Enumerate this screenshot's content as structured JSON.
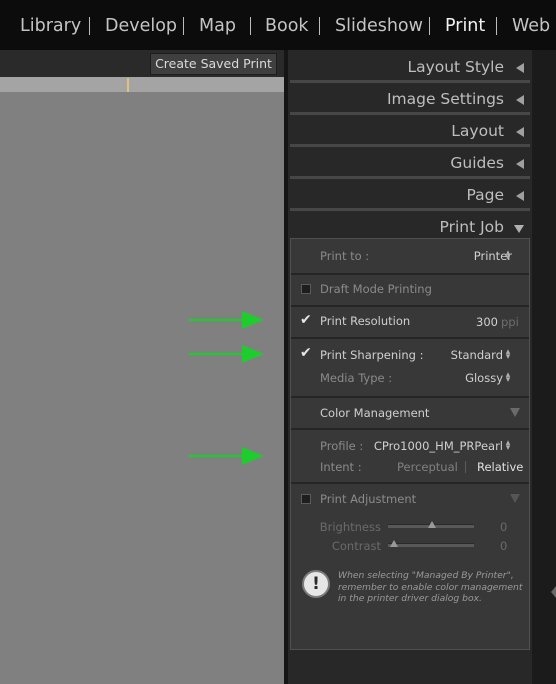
{
  "modules": [
    {
      "label": "Library",
      "active": false
    },
    {
      "label": "Develop",
      "active": false
    },
    {
      "label": "Map",
      "active": false
    },
    {
      "label": "Book",
      "active": false
    },
    {
      "label": "Slideshow",
      "active": false
    },
    {
      "label": "Print",
      "active": true
    },
    {
      "label": "Web",
      "active": false
    }
  ],
  "toolbar": {
    "create_saved_print": "Create Saved Print"
  },
  "panels": {
    "layout_style": "Layout Style",
    "image_settings": "Image Settings",
    "layout": "Layout",
    "guides": "Guides",
    "page": "Page",
    "print_job": "Print Job"
  },
  "print_job": {
    "print_to_label": "Print to :",
    "print_to_value": "Printer",
    "draft_mode": {
      "label": "Draft Mode Printing",
      "checked": false
    },
    "print_resolution": {
      "label": "Print Resolution",
      "checked": true,
      "value": "300",
      "unit": "ppi"
    },
    "print_sharpening": {
      "label": "Print Sharpening :",
      "checked": true,
      "value": "Standard"
    },
    "media_type": {
      "label": "Media Type :",
      "value": "Glossy"
    },
    "color_management": {
      "title": "Color Management",
      "profile_label": "Profile :",
      "profile_value": "CPro1000_HM_PRPearl",
      "intent_label": "Intent :",
      "intent_options": [
        "Perceptual",
        "Relative"
      ],
      "intent_selected": "Relative"
    },
    "print_adjustment": {
      "label": "Print Adjustment",
      "checked": false,
      "brightness_label": "Brightness",
      "brightness_value": "0",
      "contrast_label": "Contrast",
      "contrast_value": "0"
    },
    "notice": "When selecting \"Managed By Printer\", remember to enable color management in the printer driver dialog box."
  },
  "colors": {
    "arrow": "#1fcc2e",
    "accent_marker": "#e0c27a"
  }
}
